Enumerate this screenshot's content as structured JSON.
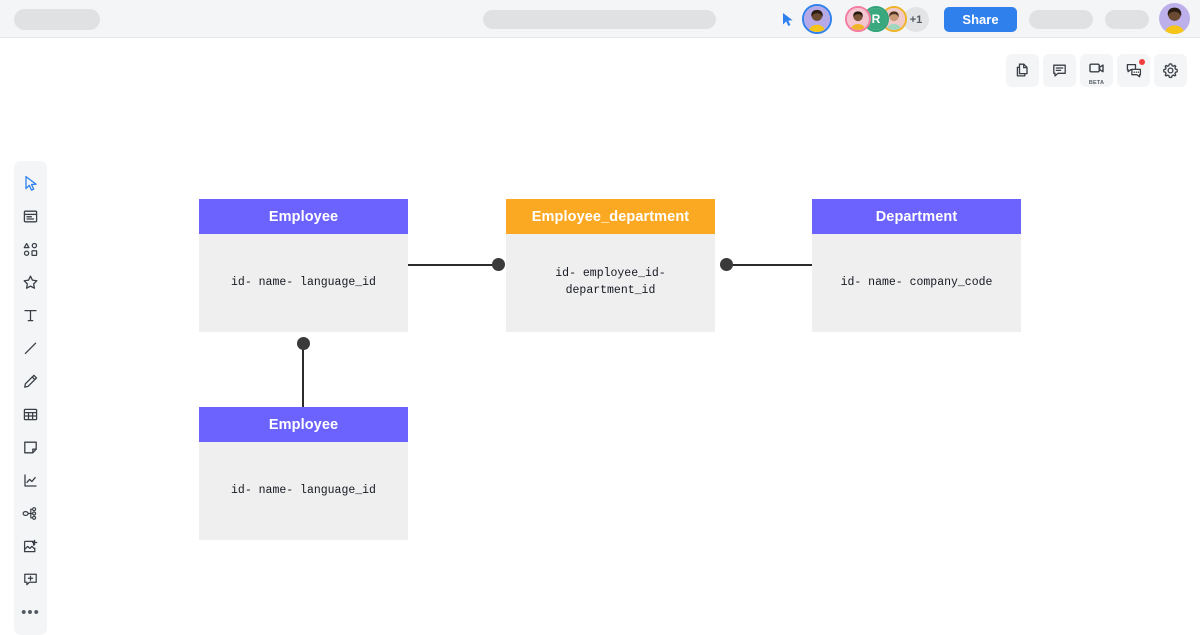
{
  "topbar": {
    "share_label": "Share",
    "collaborator_count_badge": "+1",
    "avatar_initial": "R",
    "placeholder_left": "",
    "placeholder_center": "",
    "placeholder_right_1": "",
    "placeholder_right_2": "",
    "accent_color": "#2f80ed",
    "bar_color": "#f4f5f7",
    "pill_color": "#e0e1e3",
    "icons": {
      "cursor": "cursor-pointer-icon",
      "avatar_main": "avatar-current-user",
      "avatar_1": "avatar-collaborator-1",
      "avatar_2": "avatar-collaborator-2",
      "avatar_3": "avatar-collaborator-3",
      "avatar_right": "avatar-profile"
    }
  },
  "tool_cluster": {
    "items": [
      {
        "name": "pages-icon",
        "label": "",
        "badge": ""
      },
      {
        "name": "comment-icon",
        "label": "",
        "badge": ""
      },
      {
        "name": "video-call-icon",
        "label": "BETA",
        "badge": ""
      },
      {
        "name": "chat-icon",
        "label": "",
        "badge": "notification"
      },
      {
        "name": "settings-gear-icon",
        "label": "",
        "badge": ""
      }
    ]
  },
  "left_toolbar": {
    "active_index": 0,
    "items": [
      {
        "name": "select-cursor-icon"
      },
      {
        "name": "frame-icon"
      },
      {
        "name": "shapes-icon"
      },
      {
        "name": "star-icon"
      },
      {
        "name": "text-icon"
      },
      {
        "name": "line-icon"
      },
      {
        "name": "pen-icon"
      },
      {
        "name": "table-icon"
      },
      {
        "name": "sticky-note-icon"
      },
      {
        "name": "chart-icon"
      },
      {
        "name": "mindmap-icon"
      },
      {
        "name": "image-add-icon"
      },
      {
        "name": "comment-add-icon"
      },
      {
        "name": "more-options-icon",
        "glyph": "•••"
      }
    ]
  },
  "diagram": {
    "type": "er-diagram",
    "colors": {
      "purple_header": "#6c63ff",
      "orange_header": "#fba923",
      "body_background": "#efeff0",
      "connector": "#3a3a3a"
    },
    "tables": [
      {
        "id": "employee",
        "title": "Employee",
        "header_color": "#6c63ff",
        "fields": "id- name- language_id"
      },
      {
        "id": "employee_department",
        "title": "Employee_department",
        "header_color": "#fba923",
        "fields": "id- employee_id-\ndepartment_id"
      },
      {
        "id": "department",
        "title": "Department",
        "header_color": "#6c63ff",
        "fields": "id- name- company_code"
      },
      {
        "id": "employee_2",
        "title": "Employee",
        "header_color": "#6c63ff",
        "fields": "id- name- language_id"
      }
    ],
    "connections": [
      {
        "from": "employee",
        "to": "employee_department",
        "orientation": "horizontal"
      },
      {
        "from": "employee_department",
        "to": "department",
        "orientation": "horizontal"
      },
      {
        "from": "employee",
        "to": "employee_2",
        "orientation": "vertical"
      }
    ]
  }
}
